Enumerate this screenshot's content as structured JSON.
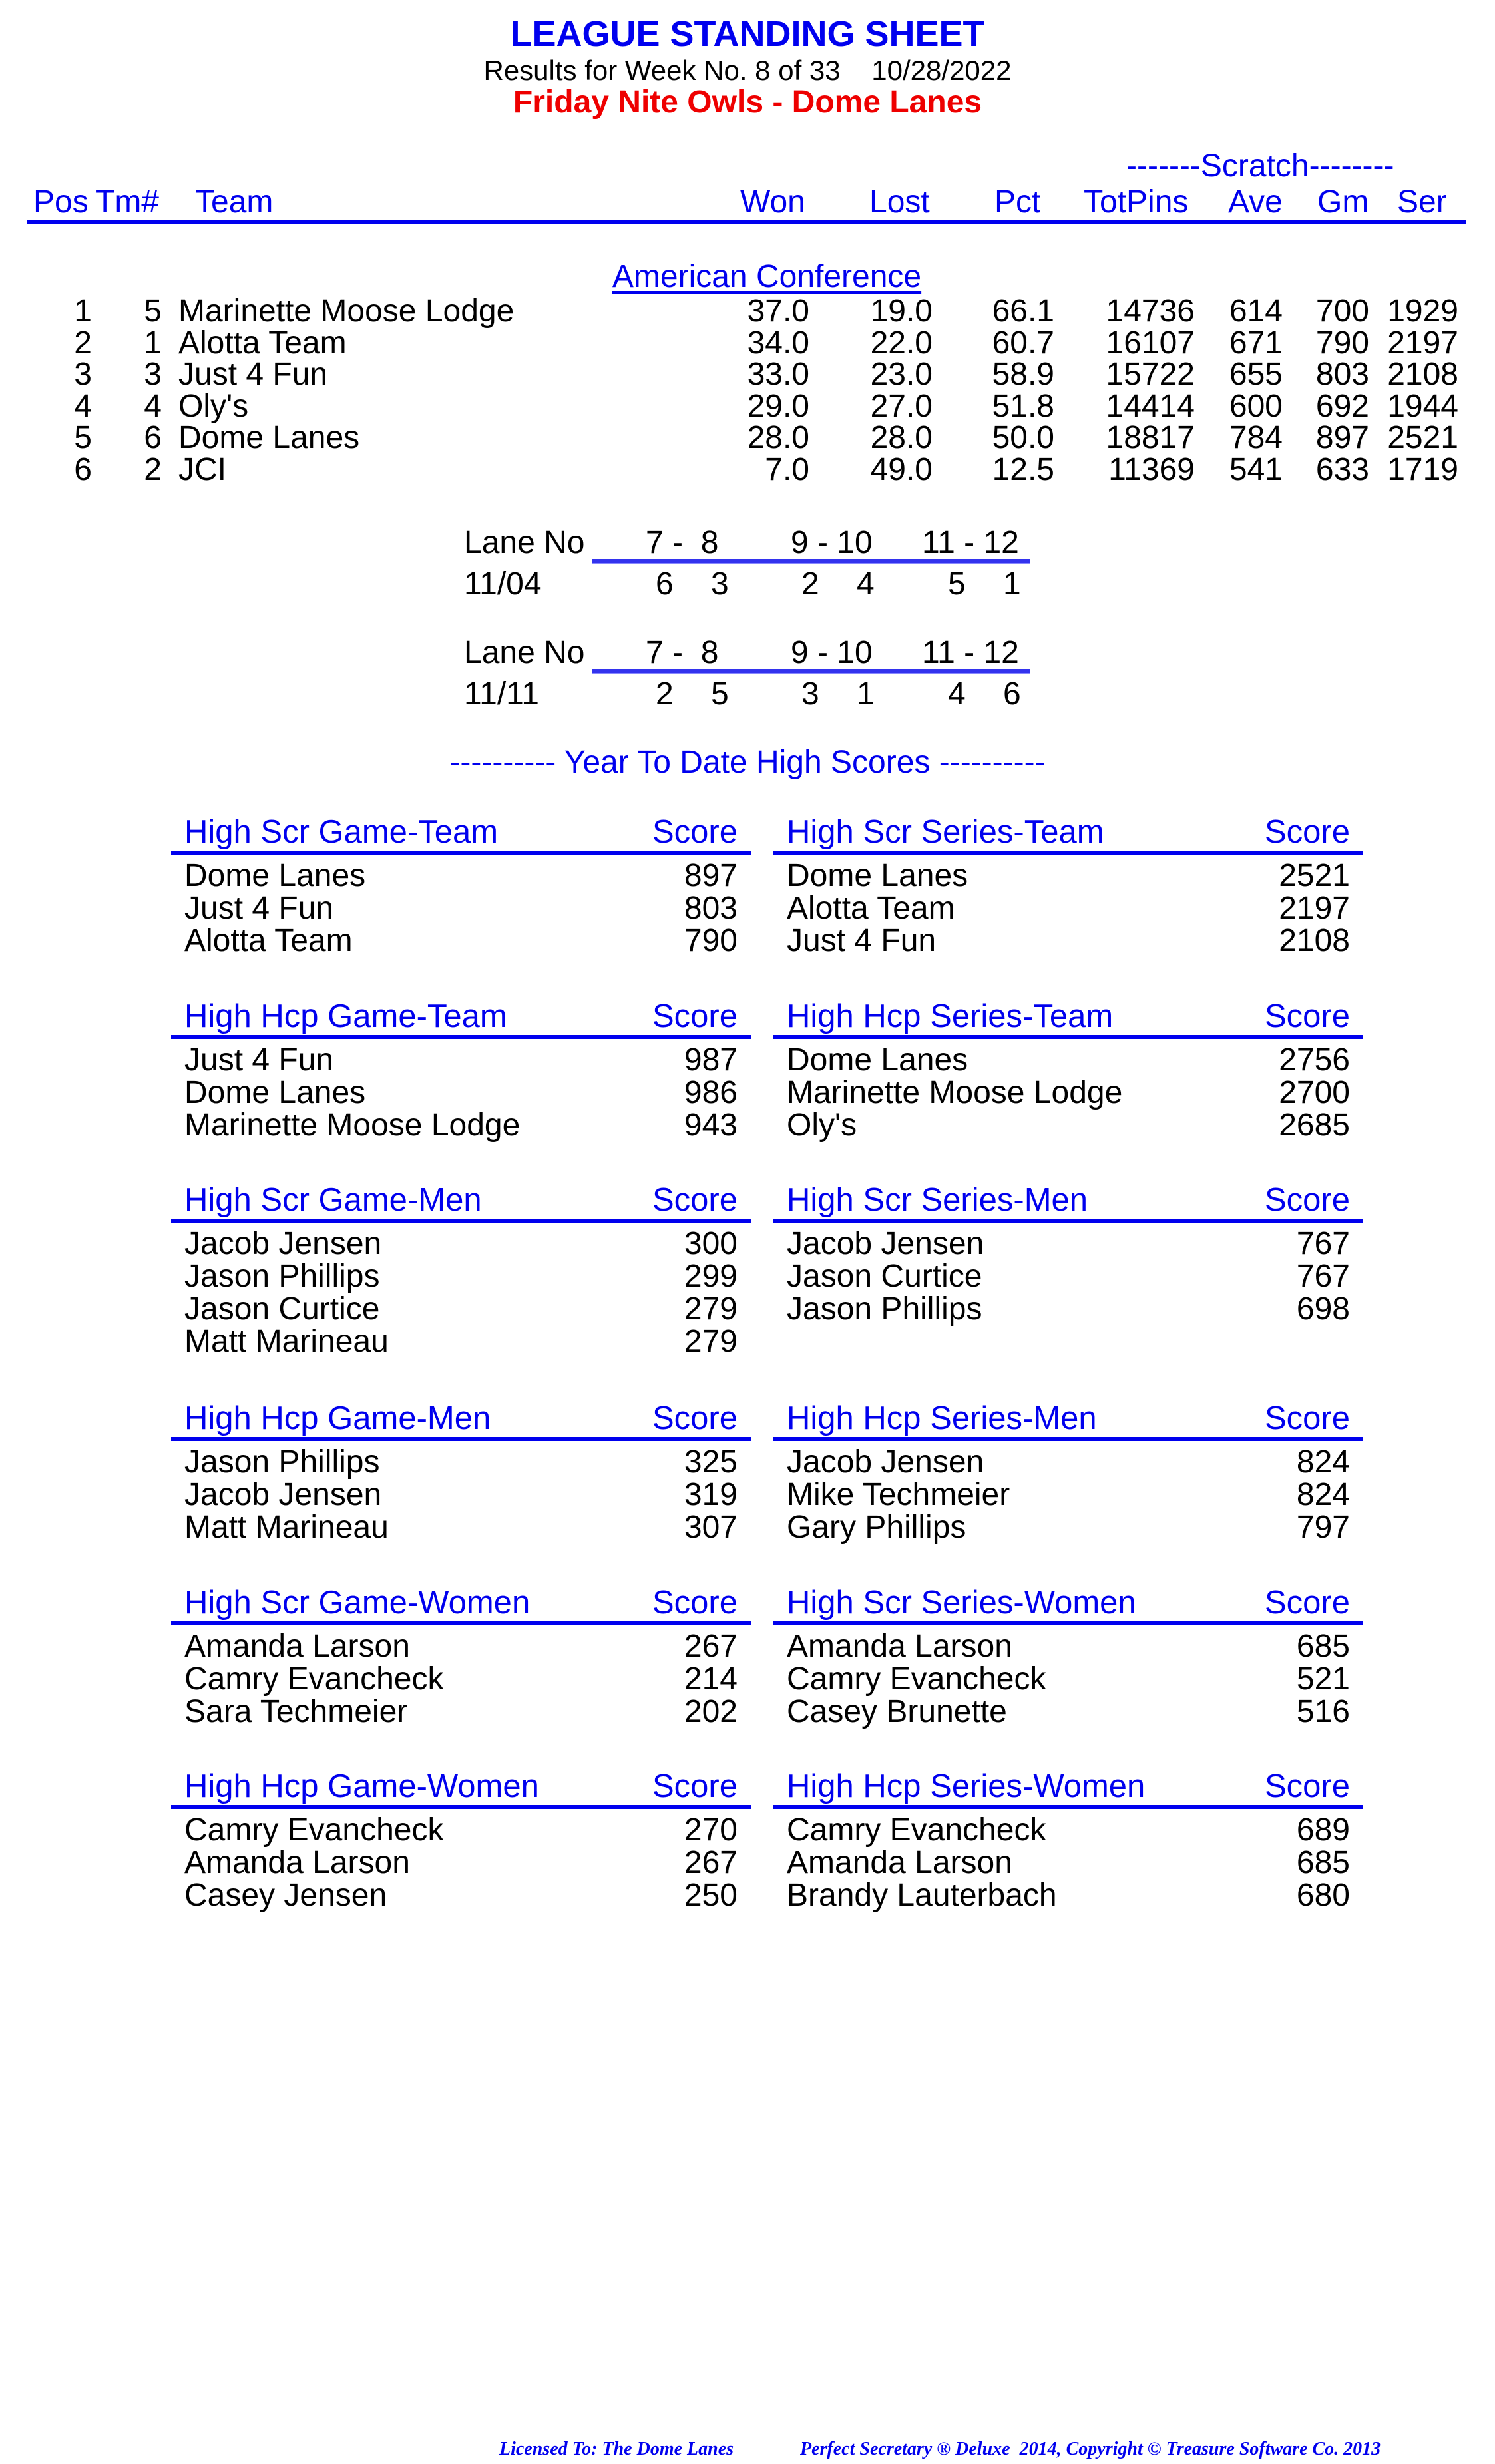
{
  "header": {
    "title": "LEAGUE STANDING SHEET",
    "subtitle": "Results for Week No. 8 of 33    10/28/2022",
    "league_name": "Friday Nite Owls - Dome Lanes"
  },
  "standings": {
    "scratch_label": "-------Scratch--------",
    "columns": {
      "pos": "Pos",
      "tm": "Tm#",
      "team": "Team",
      "won": "Won",
      "lost": "Lost",
      "pct": "Pct",
      "totpins": "TotPins",
      "ave": "Ave",
      "gm": "Gm",
      "ser": "Ser"
    },
    "conference": "American Conference",
    "rows": [
      {
        "pos": "1",
        "tm": "5",
        "team": "Marinette Moose Lodge",
        "won": "37.0",
        "lost": "19.0",
        "pct": "66.1",
        "totpins": "14736",
        "ave": "614",
        "gm": "700",
        "ser": "1929"
      },
      {
        "pos": "2",
        "tm": "1",
        "team": "Alotta Team",
        "won": "34.0",
        "lost": "22.0",
        "pct": "60.7",
        "totpins": "16107",
        "ave": "671",
        "gm": "790",
        "ser": "2197"
      },
      {
        "pos": "3",
        "tm": "3",
        "team": "Just 4 Fun",
        "won": "33.0",
        "lost": "23.0",
        "pct": "58.9",
        "totpins": "15722",
        "ave": "655",
        "gm": "803",
        "ser": "2108"
      },
      {
        "pos": "4",
        "tm": "4",
        "team": "Oly's",
        "won": "29.0",
        "lost": "27.0",
        "pct": "51.8",
        "totpins": "14414",
        "ave": "600",
        "gm": "692",
        "ser": "1944"
      },
      {
        "pos": "5",
        "tm": "6",
        "team": "Dome Lanes",
        "won": "28.0",
        "lost": "28.0",
        "pct": "50.0",
        "totpins": "18817",
        "ave": "784",
        "gm": "897",
        "ser": "2521"
      },
      {
        "pos": "6",
        "tm": "2",
        "team": "JCI",
        "won": "7.0",
        "lost": "49.0",
        "pct": "12.5",
        "totpins": "11369",
        "ave": "541",
        "gm": "633",
        "ser": "1719"
      }
    ]
  },
  "lane_assignments": [
    {
      "label": "Lane No",
      "lanes": [
        "7 -  8",
        "9 - 10",
        "11 - 12"
      ],
      "date": "11/04",
      "pairs": [
        [
          "6",
          "3"
        ],
        [
          "2",
          "4"
        ],
        [
          "5",
          "1"
        ]
      ]
    },
    {
      "label": "Lane No",
      "lanes": [
        "7 -  8",
        "9 - 10",
        "11 - 12"
      ],
      "date": "11/11",
      "pairs": [
        [
          "2",
          "5"
        ],
        [
          "3",
          "1"
        ],
        [
          "4",
          "6"
        ]
      ]
    }
  ],
  "high_scores": {
    "heading": "---------- Year To Date High Scores ----------",
    "score_label": "Score",
    "blocks": [
      {
        "title": "High Scr Game-Team",
        "entries": [
          [
            "Dome Lanes",
            "897"
          ],
          [
            "Just 4 Fun",
            "803"
          ],
          [
            "Alotta Team",
            "790"
          ]
        ]
      },
      {
        "title": "High Scr Series-Team",
        "entries": [
          [
            "Dome Lanes",
            "2521"
          ],
          [
            "Alotta Team",
            "2197"
          ],
          [
            "Just 4 Fun",
            "2108"
          ]
        ]
      },
      {
        "title": "High Hcp Game-Team",
        "entries": [
          [
            "Just 4 Fun",
            "987"
          ],
          [
            "Dome Lanes",
            "986"
          ],
          [
            "Marinette Moose Lodge",
            "943"
          ]
        ]
      },
      {
        "title": "High Hcp Series-Team",
        "entries": [
          [
            "Dome Lanes",
            "2756"
          ],
          [
            "Marinette Moose Lodge",
            "2700"
          ],
          [
            "Oly's",
            "2685"
          ]
        ]
      },
      {
        "title": "High Scr Game-Men",
        "entries": [
          [
            "Jacob Jensen",
            "300"
          ],
          [
            "Jason Phillips",
            "299"
          ],
          [
            "Jason Curtice",
            "279"
          ],
          [
            "Matt Marineau",
            "279"
          ]
        ]
      },
      {
        "title": "High Scr Series-Men",
        "entries": [
          [
            "Jacob Jensen",
            "767"
          ],
          [
            "Jason Curtice",
            "767"
          ],
          [
            "Jason Phillips",
            "698"
          ]
        ]
      },
      {
        "title": "High Hcp Game-Men",
        "entries": [
          [
            "Jason Phillips",
            "325"
          ],
          [
            "Jacob Jensen",
            "319"
          ],
          [
            "Matt Marineau",
            "307"
          ]
        ]
      },
      {
        "title": "High Hcp Series-Men",
        "entries": [
          [
            "Jacob Jensen",
            "824"
          ],
          [
            "Mike Techmeier",
            "824"
          ],
          [
            "Gary Phillips",
            "797"
          ]
        ]
      },
      {
        "title": "High Scr Game-Women",
        "entries": [
          [
            "Amanda Larson",
            "267"
          ],
          [
            "Camry Evancheck",
            "214"
          ],
          [
            "Sara Techmeier",
            "202"
          ]
        ]
      },
      {
        "title": "High Scr Series-Women",
        "entries": [
          [
            "Amanda Larson",
            "685"
          ],
          [
            "Camry Evancheck",
            "521"
          ],
          [
            "Casey Brunette",
            "516"
          ]
        ]
      },
      {
        "title": "High Hcp Game-Women",
        "entries": [
          [
            "Camry Evancheck",
            "270"
          ],
          [
            "Amanda Larson",
            "267"
          ],
          [
            "Casey Jensen",
            "250"
          ]
        ]
      },
      {
        "title": "High Hcp Series-Women",
        "entries": [
          [
            "Camry Evancheck",
            "689"
          ],
          [
            "Amanda Larson",
            "685"
          ],
          [
            "Brandy Lauterbach",
            "680"
          ]
        ]
      }
    ]
  },
  "footer": {
    "licensed": "Licensed To: The Dome Lanes",
    "copyright": "Perfect Secretary ® Deluxe  2014, Copyright © Treasure Software Co. 2013"
  },
  "colors": {
    "accent_blue": "#0000ee",
    "league_red": "#ee0000"
  }
}
